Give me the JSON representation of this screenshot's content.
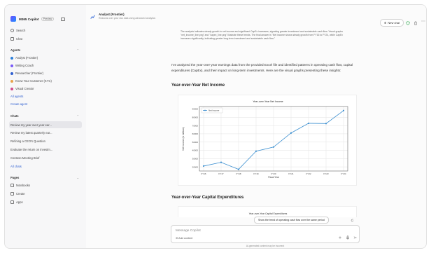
{
  "sidebar": {
    "brand": "M365 Copilot",
    "preview_badge": "Preview",
    "search": "Search",
    "chat": "Chat",
    "agents_header": "Agents",
    "agents": [
      {
        "label": "Analyst (Frontier)",
        "color": "#2b7fd9"
      },
      {
        "label": "Writing Coach",
        "color": "#7a5af8"
      },
      {
        "label": "Researcher (Frontier)",
        "color": "#2f5fd0"
      },
      {
        "label": "Know Your Customer (KYC)",
        "color": "#e8a24a"
      },
      {
        "label": "Visual Creator",
        "color": "#d04a8a"
      }
    ],
    "all_agents": "All agents",
    "create_agent": "Create agent",
    "chats_header": "Chats",
    "chats": [
      "Review my year over year ear...",
      "Review my latest quarterly ear...",
      "Refining a CEO's Question",
      "Evaluate the return on investm...",
      "Contoso Meeting Brief"
    ],
    "all_chats": "All chats",
    "pages_header": "Pages",
    "notebooks": "Notebooks",
    "create": "Create",
    "apps": "Apps"
  },
  "topbar": {
    "title": "Analyst (Frontier)",
    "subtitle": "Reasons over your raw data using advanced analytics",
    "new_chat": "New chat"
  },
  "content": {
    "quote": "The analysis indicates steady growth in net income and significant CapEx increases, signaling greater investment and sustainable cash flow. Visual graphs \"net_income_line.png\" and \"capex_line.png\" illustrate these trends. The final answer is \"Net income shows steady growth from FY16 to FY24, while CapEx increases significantly, indicating greater long-term investment and sustainable cash flow.\"",
    "paragraph": "I've analyzed the year-over-year earnings data from the provided Excel file and identified patterns in operating cash flow, capital expenditures (CapEx), and their impact on long-term investments. Here are the visual graphs presenting these insights:",
    "h_net_income": "Year-over-Year Net Income",
    "h_capex": "Year-over-Year Capital Expenditures"
  },
  "chart_data": [
    {
      "type": "line",
      "title": "Year-over-Year Net Income",
      "xlabel": "Fiscal Year",
      "ylabel": "Net Income (in millions)",
      "categories": [
        "FY16",
        "FY17",
        "FY18",
        "FY19",
        "FY20",
        "FY21",
        "FY22",
        "FY23",
        "FY24"
      ],
      "series": [
        {
          "name": "Net Income",
          "values": [
            21000,
            25500,
            17000,
            39000,
            44000,
            61000,
            72700,
            72400,
            88100
          ],
          "color": "#3b8fd0"
        }
      ],
      "yticks": [
        20000,
        30000,
        40000,
        50000,
        60000,
        70000,
        80000,
        90000
      ],
      "ylim": [
        15000,
        93000
      ],
      "grid": true,
      "legend": "top-left"
    },
    {
      "type": "line",
      "title": "Year-over-Year Capital Expenditures"
    }
  ],
  "suggestion": "Show the trend of operating cash flow over the same period",
  "composer": {
    "placeholder": "Message Copilot",
    "add_content": "Add content"
  },
  "disclaimer": "AI-generated content may be incorrect"
}
